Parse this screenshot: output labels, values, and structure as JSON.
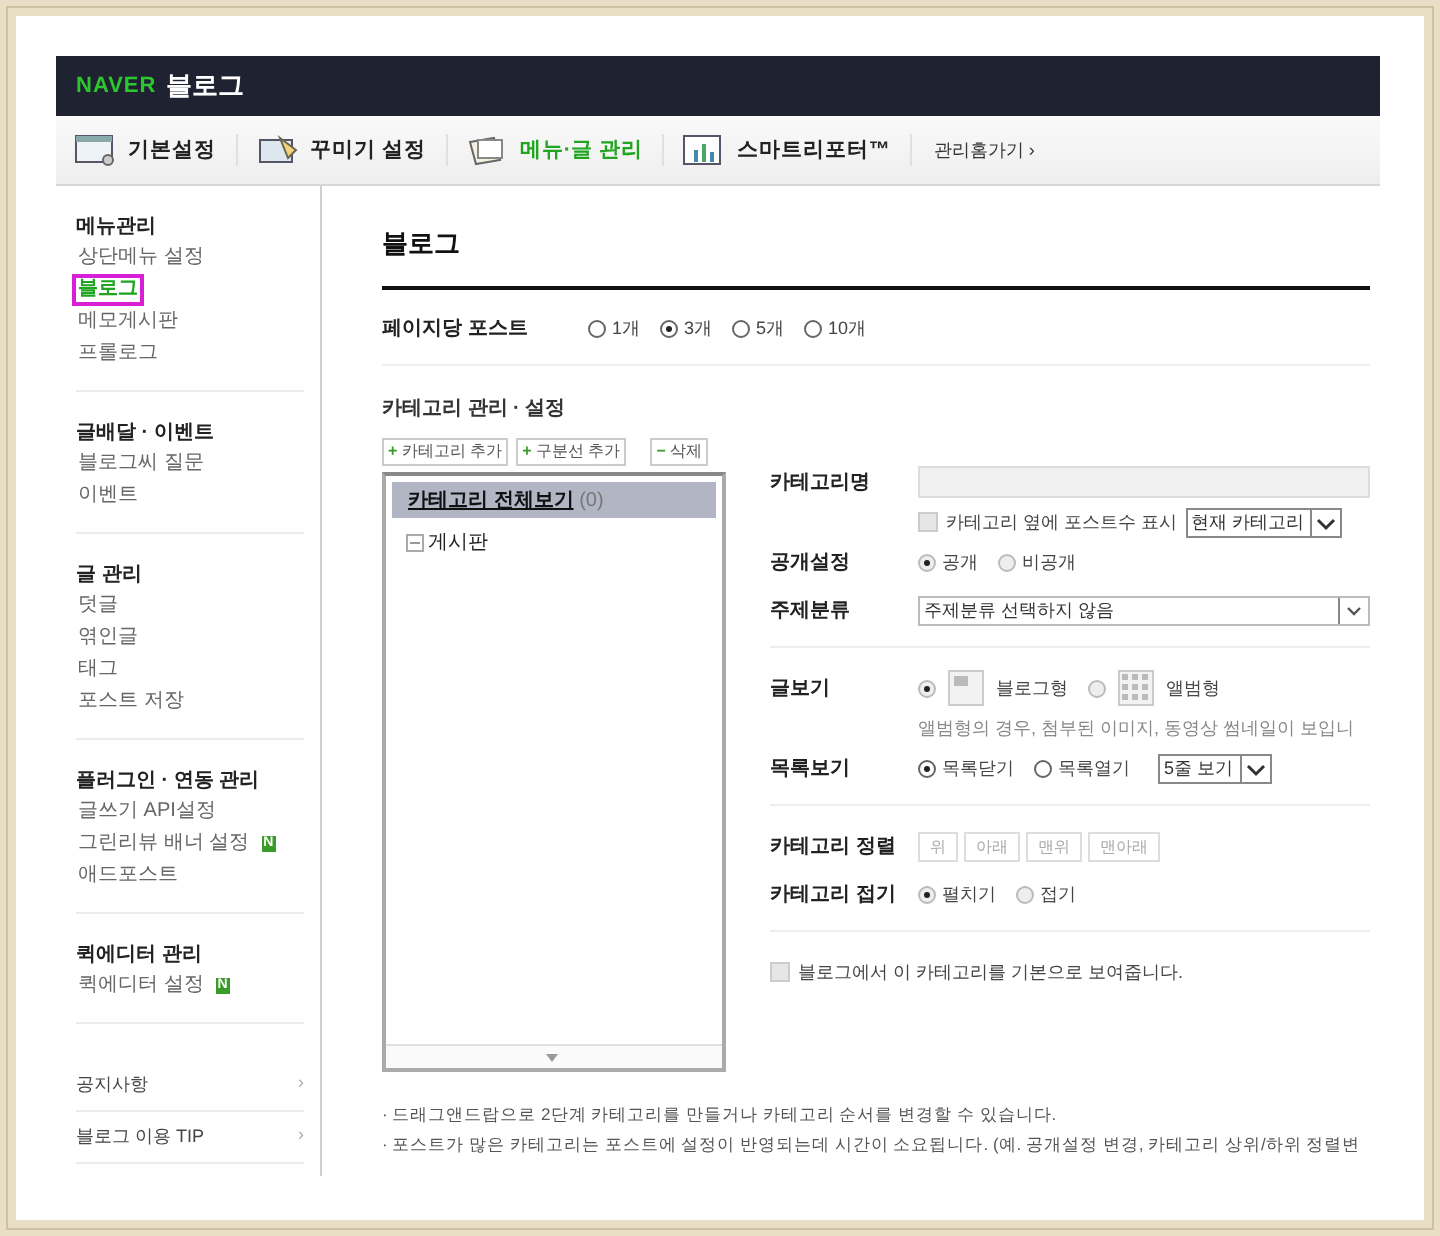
{
  "header": {
    "logo": "NAVER",
    "title": "블로그"
  },
  "nav": {
    "tabs": [
      {
        "label": "기본설정",
        "selected": false
      },
      {
        "label": "꾸미기 설정",
        "selected": false
      },
      {
        "label": "메뉴·글 관리",
        "selected": true
      },
      {
        "label": "스마트리포터™",
        "selected": false
      }
    ],
    "home_link": "관리홈가기 ›"
  },
  "sidebar": {
    "groups": [
      {
        "title": "메뉴관리",
        "items": [
          {
            "label": "상단메뉴 설정",
            "selected": false
          },
          {
            "label": "블로그",
            "selected": true
          },
          {
            "label": "메모게시판",
            "selected": false
          },
          {
            "label": "프롤로그",
            "selected": false
          }
        ]
      },
      {
        "title": "글배달 · 이벤트",
        "items": [
          {
            "label": "블로그씨 질문",
            "selected": false
          },
          {
            "label": "이벤트",
            "selected": false
          }
        ]
      },
      {
        "title": "글 관리",
        "items": [
          {
            "label": "덧글",
            "selected": false
          },
          {
            "label": "엮인글",
            "selected": false
          },
          {
            "label": "태그",
            "selected": false
          },
          {
            "label": "포스트 저장",
            "selected": false
          }
        ]
      },
      {
        "title": "플러그인 · 연동 관리",
        "items": [
          {
            "label": "글쓰기 API설정",
            "selected": false
          },
          {
            "label": "그린리뷰 배너 설정",
            "selected": false,
            "badge": "N"
          },
          {
            "label": "애드포스트",
            "selected": false
          }
        ]
      },
      {
        "title": "퀵에디터 관리",
        "items": [
          {
            "label": "퀵에디터 설정",
            "selected": false,
            "badge": "N"
          }
        ]
      }
    ],
    "links": [
      {
        "label": "공지사항",
        "arrow": "›"
      },
      {
        "label": "블로그 이용 TIP",
        "arrow": "›"
      }
    ]
  },
  "content": {
    "title": "블로그",
    "posts_per_page": {
      "label": "페이지당 포스트",
      "options": [
        {
          "label": "1개",
          "selected": false
        },
        {
          "label": "3개",
          "selected": true
        },
        {
          "label": "5개",
          "selected": false
        },
        {
          "label": "10개",
          "selected": false
        }
      ]
    },
    "category_title": "카테고리 관리 · 설정",
    "buttons": [
      {
        "sign": "+",
        "label": "카테고리 추가"
      },
      {
        "sign": "+",
        "label": "구분선 추가"
      },
      {
        "sign": "−",
        "label": "삭제"
      }
    ],
    "tree": {
      "label": "카테고리 전체보기",
      "count": "(0)",
      "selected": true,
      "children": [
        {
          "label": "게시판",
          "selected": false
        }
      ]
    },
    "settings": {
      "category_name": {
        "label": "카테고리명",
        "checkbox": {
          "label": "카테고리 옆에 포스트수 표시",
          "checked": false
        },
        "select": "현재 카테고리"
      },
      "visibility": {
        "label": "공개설정",
        "options": [
          {
            "label": "공개",
            "selected": true
          },
          {
            "label": "비공개",
            "selected": false
          }
        ]
      },
      "topic": {
        "label": "주제분류",
        "select": "주제분류 선택하지 않음"
      },
      "view": {
        "label": "글보기",
        "options": [
          {
            "label": "블로그형",
            "kind": "blog",
            "selected": true
          },
          {
            "label": "앨범형",
            "kind": "album",
            "selected": false
          }
        ],
        "note": "앨범형의 경우, 첨부된 이미지, 동영상 썸네일이 보입니"
      },
      "list_view": {
        "label": "목록보기",
        "options": [
          {
            "label": "목록닫기",
            "selected": true
          },
          {
            "label": "목록열기",
            "selected": false
          }
        ],
        "select": "5줄 보기"
      },
      "sort": {
        "label": "카테고리 정렬",
        "buttons": [
          "위",
          "아래",
          "맨위",
          "맨아래"
        ]
      },
      "fold": {
        "label": "카테고리 접기",
        "options": [
          {
            "label": "펼치기",
            "selected": true
          },
          {
            "label": "접기",
            "selected": false
          }
        ]
      },
      "default_checkbox": {
        "label": "블로그에서 이 카테고리를 기본으로 보여줍니다.",
        "checked": false
      }
    },
    "notes": [
      "· 드래그앤드랍으로 2단계 카테고리를 만들거나 카테고리 순서를 변경할 수 있습니다.",
      "· 포스트가 많은 카테고리는 포스트에 설정이 반영되는데 시간이 소요됩니다. (예. 공개설정 변경, 카테고리 상위/하위 정렬변"
    ]
  }
}
